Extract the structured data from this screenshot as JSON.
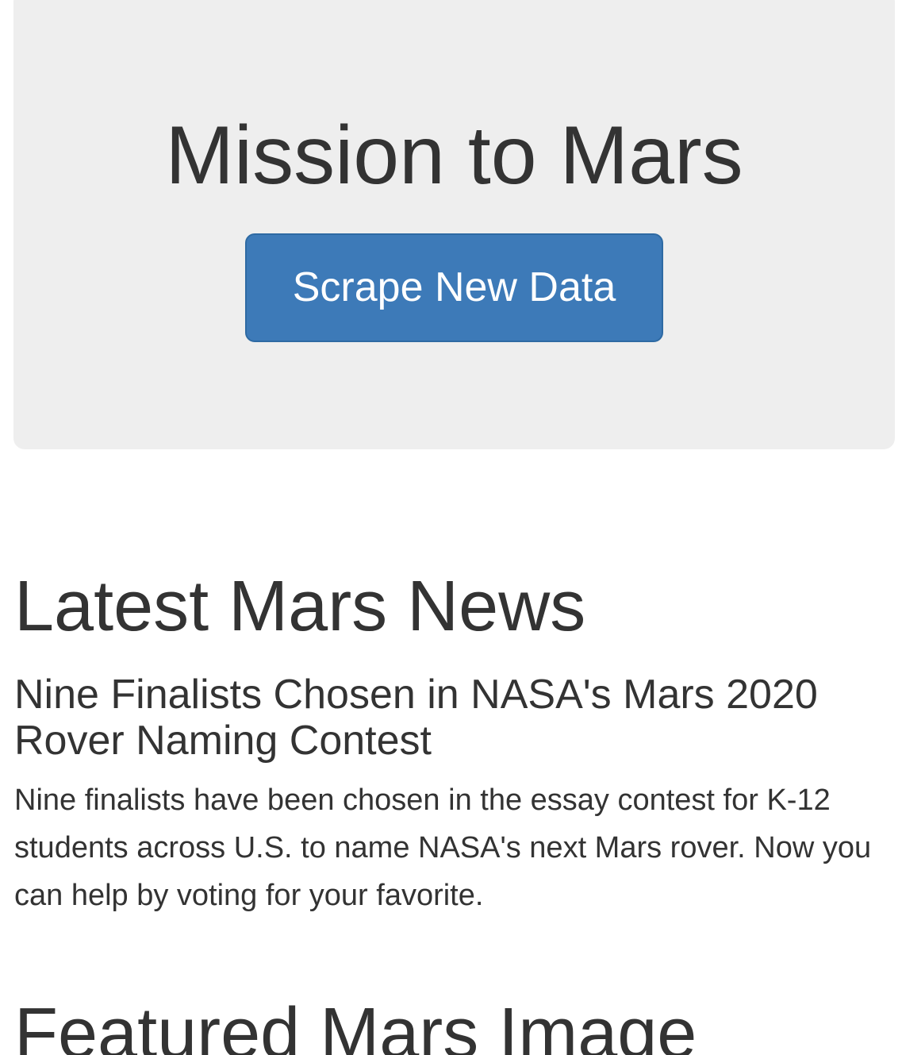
{
  "jumbotron": {
    "title": "Mission to Mars",
    "button_label": "Scrape New Data"
  },
  "news": {
    "section_title": "Latest Mars News",
    "headline": "Nine Finalists Chosen in NASA's Mars 2020 Rover Naming Contest",
    "teaser": "Nine finalists have been chosen in the essay contest for K-12 students across U.S. to name NASA's next Mars rover. Now you can help by voting for your favorite."
  },
  "featured_image": {
    "section_title": "Featured Mars Image"
  }
}
